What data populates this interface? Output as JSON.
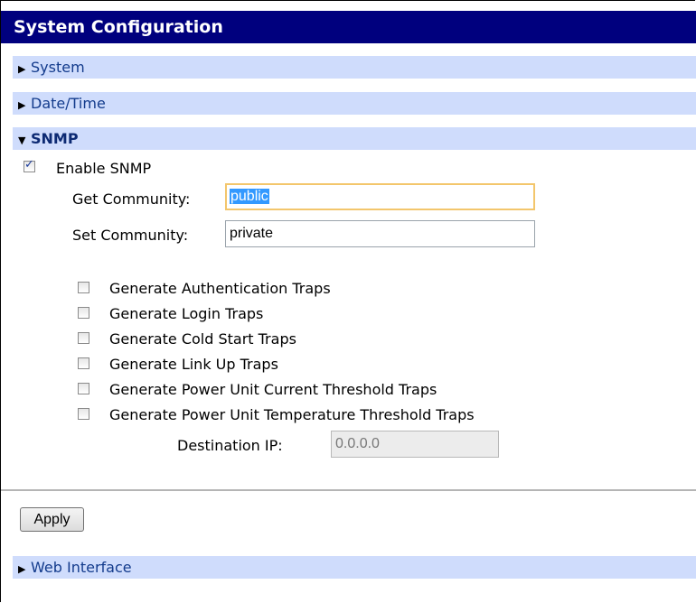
{
  "title": "System Configuration",
  "sections": {
    "system": "System",
    "datetime": "Date/Time",
    "snmp": "SNMP",
    "web": "Web Interface"
  },
  "snmp": {
    "enable_label": "Enable SNMP",
    "enable_checked": true,
    "get_label": "Get Community:",
    "get_value": "public",
    "set_label": "Set Community:",
    "set_value": "private",
    "traps": [
      {
        "label": "Generate Authentication Traps",
        "checked": false
      },
      {
        "label": "Generate Login Traps",
        "checked": false
      },
      {
        "label": "Generate Cold Start Traps",
        "checked": false
      },
      {
        "label": "Generate Link Up Traps",
        "checked": false
      },
      {
        "label": "Generate Power Unit Current Threshold Traps",
        "checked": false
      },
      {
        "label": "Generate Power Unit Temperature Threshold Traps",
        "checked": false
      }
    ],
    "dest_label": "Destination IP:",
    "dest_value": "0.0.0.0"
  },
  "apply_label": "Apply",
  "colors": {
    "titlebar": "#00007e",
    "section_bg": "#cfdcfc",
    "focus_border": "#f3c66c"
  }
}
